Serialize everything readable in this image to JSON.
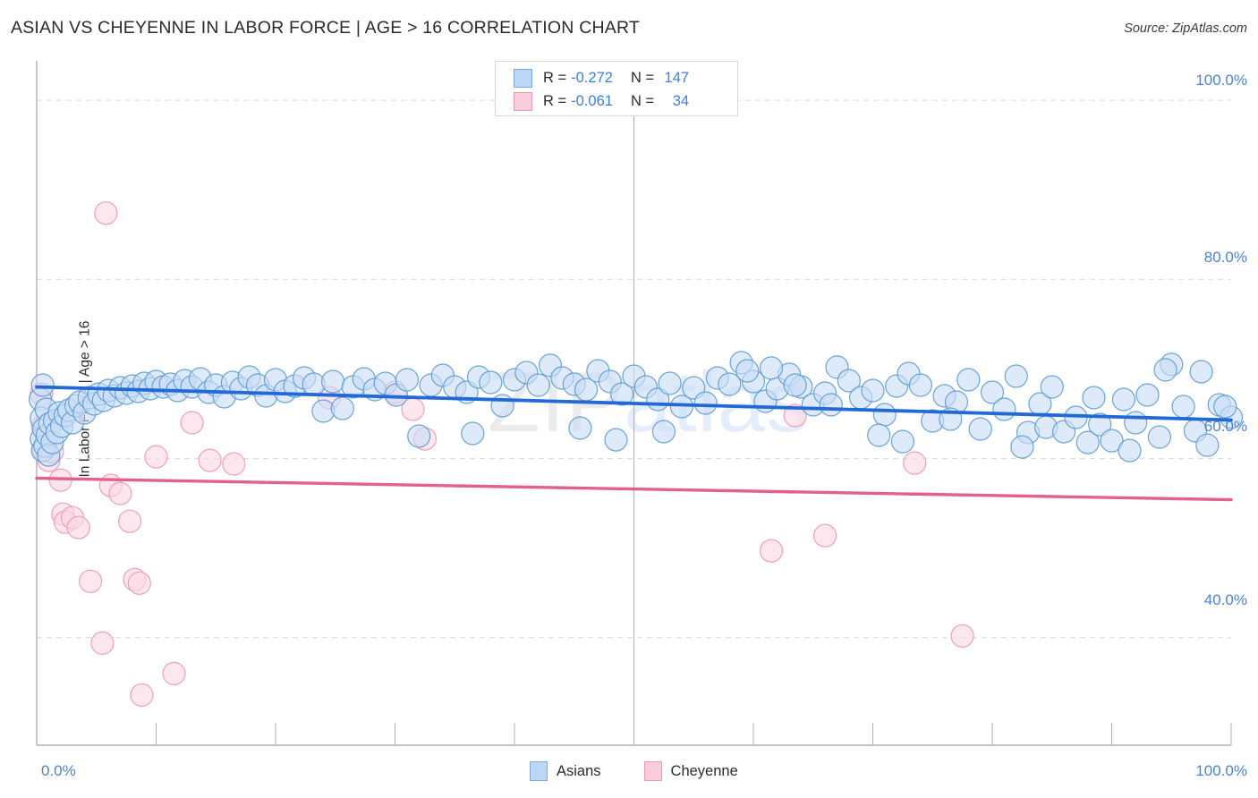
{
  "header": {
    "title": "ASIAN VS CHEYENNE IN LABOR FORCE | AGE > 16 CORRELATION CHART",
    "source": "Source: ZipAtlas.com"
  },
  "watermark": {
    "part1": "ZIP",
    "part2": "atlas"
  },
  "axes": {
    "y_title": "In Labor Force | Age > 16",
    "y_ticks": [
      "100.0%",
      "80.0%",
      "60.0%",
      "40.0%"
    ],
    "x_ticks": [
      "0.0%",
      "100.0%"
    ]
  },
  "stats_legend": {
    "rows": [
      {
        "color": "#bcd6f5",
        "r_label": "R =",
        "r_value": "-0.272",
        "n_label": "N =",
        "n_value": "147"
      },
      {
        "color": "#f9cdd9",
        "r_label": "R =",
        "r_value": "-0.061",
        "n_label": "N =",
        "n_value": "34"
      }
    ]
  },
  "series_legend": [
    {
      "label": "Asians",
      "color": "#bcd6f5",
      "border": "#7aaae0"
    },
    {
      "label": "Cheyenne",
      "color": "#f9cdd9",
      "border": "#eb9ab4"
    }
  ],
  "colors": {
    "asian_fill": "#c9ddf6",
    "asian_stroke": "#5b9bd5",
    "cheyenne_fill": "#fbd9e3",
    "cheyenne_stroke": "#ef96b3",
    "asian_trend": "#2069d6",
    "cheyenne_trend": "#e35f8c",
    "grid": "#d9d9d9",
    "axis": "#b0b0b0",
    "tick_text": "#4a83d6"
  },
  "chart_data": {
    "type": "scatter",
    "title": "ASIAN VS CHEYENNE IN LABOR FORCE | AGE > 16 CORRELATION CHART",
    "xlabel": "",
    "ylabel": "In Labor Force | Age > 16",
    "xlim": [
      0,
      100
    ],
    "ylim": [
      28,
      104
    ],
    "grid": true,
    "y_gridlines": [
      100,
      80,
      60,
      40
    ],
    "legend_position": "bottom-center",
    "series": [
      {
        "name": "Asians",
        "color": "#c9ddf6",
        "stroke": "#5b9bd5",
        "r": -0.272,
        "n": 147,
        "trendline": {
          "x0": 0,
          "y0": 68.0,
          "x1": 100,
          "y1": 64.3
        },
        "points": [
          [
            0.3,
            66.6
          ],
          [
            0.4,
            64.5
          ],
          [
            0.4,
            62.2
          ],
          [
            0.5,
            60.9
          ],
          [
            0.5,
            68.2
          ],
          [
            0.6,
            63.3
          ],
          [
            0.7,
            61.4
          ],
          [
            0.8,
            65.5
          ],
          [
            0.9,
            62.6
          ],
          [
            1.0,
            60.4
          ],
          [
            1.1,
            63.9
          ],
          [
            1.3,
            61.8
          ],
          [
            1.5,
            64.2
          ],
          [
            1.7,
            62.9
          ],
          [
            1.9,
            65.1
          ],
          [
            2.1,
            63.6
          ],
          [
            2.4,
            64.8
          ],
          [
            2.7,
            65.4
          ],
          [
            3.0,
            64.0
          ],
          [
            3.3,
            65.9
          ],
          [
            3.6,
            66.3
          ],
          [
            4.0,
            65.1
          ],
          [
            4.4,
            66.8
          ],
          [
            4.8,
            66.1
          ],
          [
            5.2,
            67.2
          ],
          [
            5.6,
            66.5
          ],
          [
            6.0,
            67.6
          ],
          [
            6.5,
            67.0
          ],
          [
            7.0,
            67.9
          ],
          [
            7.5,
            67.3
          ],
          [
            8.0,
            68.1
          ],
          [
            8.5,
            67.5
          ],
          [
            9.0,
            68.4
          ],
          [
            9.5,
            67.8
          ],
          [
            10.0,
            68.6
          ],
          [
            10.6,
            68.0
          ],
          [
            11.2,
            68.3
          ],
          [
            11.8,
            67.6
          ],
          [
            12.4,
            68.7
          ],
          [
            13.0,
            68.0
          ],
          [
            13.7,
            68.9
          ],
          [
            14.4,
            67.4
          ],
          [
            15.0,
            68.2
          ],
          [
            15.7,
            66.9
          ],
          [
            16.4,
            68.5
          ],
          [
            17.1,
            67.8
          ],
          [
            17.8,
            69.1
          ],
          [
            18.5,
            68.2
          ],
          [
            19.2,
            67.0
          ],
          [
            20.0,
            68.8
          ],
          [
            20.8,
            67.5
          ],
          [
            21.6,
            68.1
          ],
          [
            22.4,
            69.0
          ],
          [
            23.2,
            68.3
          ],
          [
            24.0,
            65.3
          ],
          [
            24.8,
            68.6
          ],
          [
            25.6,
            65.6
          ],
          [
            26.5,
            68.0
          ],
          [
            27.4,
            68.9
          ],
          [
            28.3,
            67.7
          ],
          [
            29.2,
            68.4
          ],
          [
            30.1,
            67.1
          ],
          [
            31.0,
            68.8
          ],
          [
            32.0,
            62.5
          ],
          [
            33.0,
            68.2
          ],
          [
            34.0,
            69.3
          ],
          [
            35.0,
            68.0
          ],
          [
            36.0,
            67.4
          ],
          [
            37.0,
            69.1
          ],
          [
            38.0,
            68.5
          ],
          [
            39.0,
            65.9
          ],
          [
            40.0,
            68.8
          ],
          [
            41.0,
            69.6
          ],
          [
            42.0,
            68.2
          ],
          [
            43.0,
            70.4
          ],
          [
            44.0,
            69.0
          ],
          [
            45.0,
            68.3
          ],
          [
            46.0,
            67.7
          ],
          [
            47.0,
            69.8
          ],
          [
            48.0,
            68.6
          ],
          [
            49.0,
            67.2
          ],
          [
            50.0,
            69.2
          ],
          [
            51.0,
            68.0
          ],
          [
            52.0,
            66.6
          ],
          [
            53.0,
            68.4
          ],
          [
            54.0,
            65.8
          ],
          [
            55.0,
            67.9
          ],
          [
            56.0,
            66.2
          ],
          [
            57.0,
            69.0
          ],
          [
            58.0,
            68.3
          ],
          [
            59.0,
            70.7
          ],
          [
            60.0,
            68.6
          ],
          [
            61.0,
            66.4
          ],
          [
            62.0,
            67.8
          ],
          [
            63.0,
            69.4
          ],
          [
            64.0,
            68.0
          ],
          [
            65.0,
            66.0
          ],
          [
            66.0,
            67.3
          ],
          [
            67.0,
            70.2
          ],
          [
            68.0,
            68.7
          ],
          [
            69.0,
            66.8
          ],
          [
            70.0,
            67.6
          ],
          [
            71.0,
            64.9
          ],
          [
            72.0,
            68.1
          ],
          [
            73.0,
            69.5
          ],
          [
            74.0,
            68.2
          ],
          [
            75.0,
            64.2
          ],
          [
            76.0,
            67.0
          ],
          [
            77.0,
            66.3
          ],
          [
            78.0,
            68.8
          ],
          [
            79.0,
            63.3
          ],
          [
            80.0,
            67.4
          ],
          [
            81.0,
            65.5
          ],
          [
            82.0,
            69.2
          ],
          [
            83.0,
            62.9
          ],
          [
            84.0,
            66.1
          ],
          [
            84.5,
            63.5
          ],
          [
            85.0,
            68.0
          ],
          [
            86.0,
            63.0
          ],
          [
            87.0,
            64.6
          ],
          [
            88.0,
            61.8
          ],
          [
            89.0,
            63.8
          ],
          [
            90.0,
            62.0
          ],
          [
            91.0,
            66.6
          ],
          [
            92.0,
            64.0
          ],
          [
            93.0,
            67.1
          ],
          [
            94.0,
            62.4
          ],
          [
            95.0,
            70.5
          ],
          [
            96.0,
            65.8
          ],
          [
            97.0,
            63.1
          ],
          [
            98.0,
            61.5
          ],
          [
            99.0,
            66.0
          ],
          [
            100.0,
            64.6
          ],
          [
            59.5,
            69.8
          ],
          [
            61.5,
            70.1
          ],
          [
            63.5,
            68.2
          ],
          [
            66.5,
            66.0
          ],
          [
            70.5,
            62.6
          ],
          [
            72.5,
            61.9
          ],
          [
            76.5,
            64.4
          ],
          [
            82.5,
            61.3
          ],
          [
            88.5,
            66.8
          ],
          [
            91.5,
            60.9
          ],
          [
            94.5,
            69.9
          ],
          [
            97.5,
            69.7
          ],
          [
            99.5,
            65.8
          ],
          [
            45.5,
            63.4
          ],
          [
            48.5,
            62.1
          ],
          [
            52.5,
            63.0
          ],
          [
            36.5,
            62.8
          ]
        ]
      },
      {
        "name": "Cheyenne",
        "color": "#fbd9e3",
        "stroke": "#ef96b3",
        "r": -0.061,
        "n": 34,
        "trendline": {
          "x0": 0,
          "y0": 57.8,
          "x1": 100,
          "y1": 55.4
        },
        "points": [
          [
            0.4,
            67.2
          ],
          [
            0.5,
            63.6
          ],
          [
            0.6,
            61.0
          ],
          [
            0.8,
            62.4
          ],
          [
            1.0,
            59.8
          ],
          [
            1.3,
            60.8
          ],
          [
            5.8,
            87.4
          ],
          [
            2.0,
            57.6
          ],
          [
            2.2,
            53.8
          ],
          [
            2.4,
            52.9
          ],
          [
            3.0,
            53.4
          ],
          [
            3.5,
            52.3
          ],
          [
            4.5,
            46.3
          ],
          [
            5.5,
            39.4
          ],
          [
            6.2,
            57.0
          ],
          [
            7.0,
            56.1
          ],
          [
            7.8,
            53.0
          ],
          [
            8.2,
            46.5
          ],
          [
            8.6,
            46.1
          ],
          [
            8.8,
            33.6
          ],
          [
            10.0,
            60.2
          ],
          [
            11.5,
            36.0
          ],
          [
            13.0,
            64.0
          ],
          [
            14.5,
            59.8
          ],
          [
            16.5,
            59.4
          ],
          [
            24.5,
            66.8
          ],
          [
            30.0,
            67.4
          ],
          [
            31.5,
            65.5
          ],
          [
            32.5,
            62.2
          ],
          [
            63.5,
            64.8
          ],
          [
            66.0,
            51.4
          ],
          [
            61.5,
            49.7
          ],
          [
            73.5,
            59.5
          ],
          [
            77.5,
            40.2
          ]
        ]
      }
    ]
  }
}
